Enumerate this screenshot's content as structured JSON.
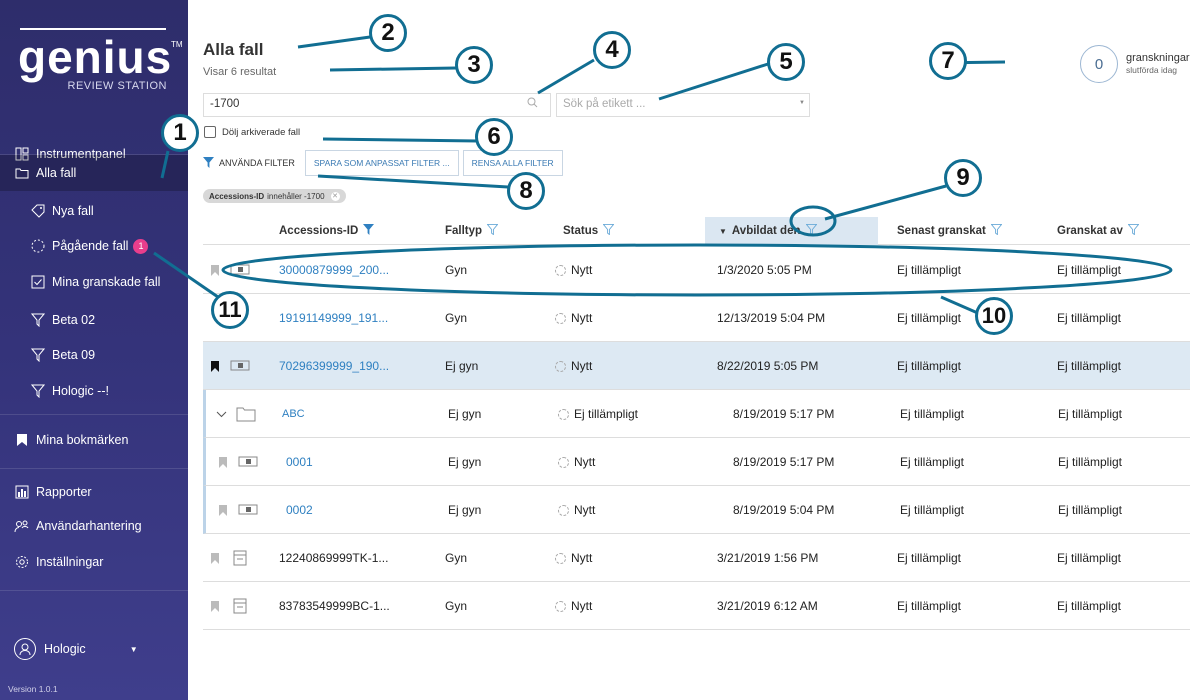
{
  "sidebar": {
    "logo": "genius",
    "logo_tm": "TM",
    "logo_sub": "REVIEW STATION",
    "items": [
      {
        "label": "Instrumentpanel"
      },
      {
        "label": "Alla fall"
      },
      {
        "label": "Nya fall"
      },
      {
        "label": "Pågående fall",
        "badge": "1"
      },
      {
        "label": "Mina granskade fall"
      },
      {
        "label": "Beta 02"
      },
      {
        "label": "Beta 09"
      },
      {
        "label": "Hologic --!"
      },
      {
        "label": "Mina bokmärken"
      },
      {
        "label": "Rapporter"
      },
      {
        "label": "Användarhantering"
      },
      {
        "label": "Inställningar"
      }
    ],
    "user": "Hologic",
    "version": "Version 1.0.1"
  },
  "header": {
    "title": "Alla fall",
    "subtitle": "Visar 6 resultat",
    "search_value": "-1700",
    "tag_placeholder": "Sök på etikett ...",
    "reviews_count": "0",
    "reviews_label": "granskningar",
    "reviews_sub": "slutförda idag",
    "hide_archived": "Dölj arkiverade fall",
    "filter_label": "ANVÄNDA FILTER",
    "save_filter": "SPARA SOM ANPASSAT FILTER ...",
    "clear_filter": "RENSA ALLA FILTER",
    "chip_key": "Accessions-ID",
    "chip_rest": "innehåller -1700"
  },
  "table": {
    "columns": [
      "Accessions-ID",
      "Falltyp",
      "Status",
      "Avbildat den",
      "Senast granskat",
      "Granskat av"
    ],
    "rows": [
      {
        "id": "30000879999_200...",
        "type": "Gyn",
        "status": "Nytt",
        "date": "1/3/2020 5:05 PM",
        "last": "Ej tillämpligt",
        "by": "Ej tillämpligt"
      },
      {
        "id": "19191149999_191...",
        "type": "Gyn",
        "status": "Nytt",
        "date": "12/13/2019 5:04 PM",
        "last": "Ej tillämpligt",
        "by": "Ej tillämpligt"
      },
      {
        "id": "70296399999_190...",
        "type": "Ej gyn",
        "status": "Nytt",
        "date": "8/22/2019 5:05 PM",
        "last": "Ej tillämpligt",
        "by": "Ej tillämpligt"
      },
      {
        "id": "ABC",
        "type": "Ej gyn",
        "status": "Ej tillämpligt",
        "date": "8/19/2019 5:17 PM",
        "last": "Ej tillämpligt",
        "by": "Ej tillämpligt"
      },
      {
        "id": "0001",
        "type": "Ej gyn",
        "status": "Nytt",
        "date": "8/19/2019 5:17 PM",
        "last": "Ej tillämpligt",
        "by": "Ej tillämpligt"
      },
      {
        "id": "0002",
        "type": "Ej gyn",
        "status": "Nytt",
        "date": "8/19/2019 5:04 PM",
        "last": "Ej tillämpligt",
        "by": "Ej tillämpligt"
      },
      {
        "id": "12240869999TK-1...",
        "type": "Gyn",
        "status": "Nytt",
        "date": "3/21/2019 1:56 PM",
        "last": "Ej tillämpligt",
        "by": "Ej tillämpligt"
      },
      {
        "id": "83783549999BC-1...",
        "type": "Gyn",
        "status": "Nytt",
        "date": "3/21/2019 6:12 AM",
        "last": "Ej tillämpligt",
        "by": "Ej tillämpligt"
      }
    ]
  },
  "callouts": [
    "1",
    "2",
    "3",
    "4",
    "5",
    "6",
    "7",
    "8",
    "9",
    "10",
    "11"
  ],
  "colors": {
    "sidebar": "#34337a",
    "accent": "#2f80c1",
    "callout": "#116e92",
    "badge": "#e83e8c",
    "highlight": "#dde9f3"
  }
}
